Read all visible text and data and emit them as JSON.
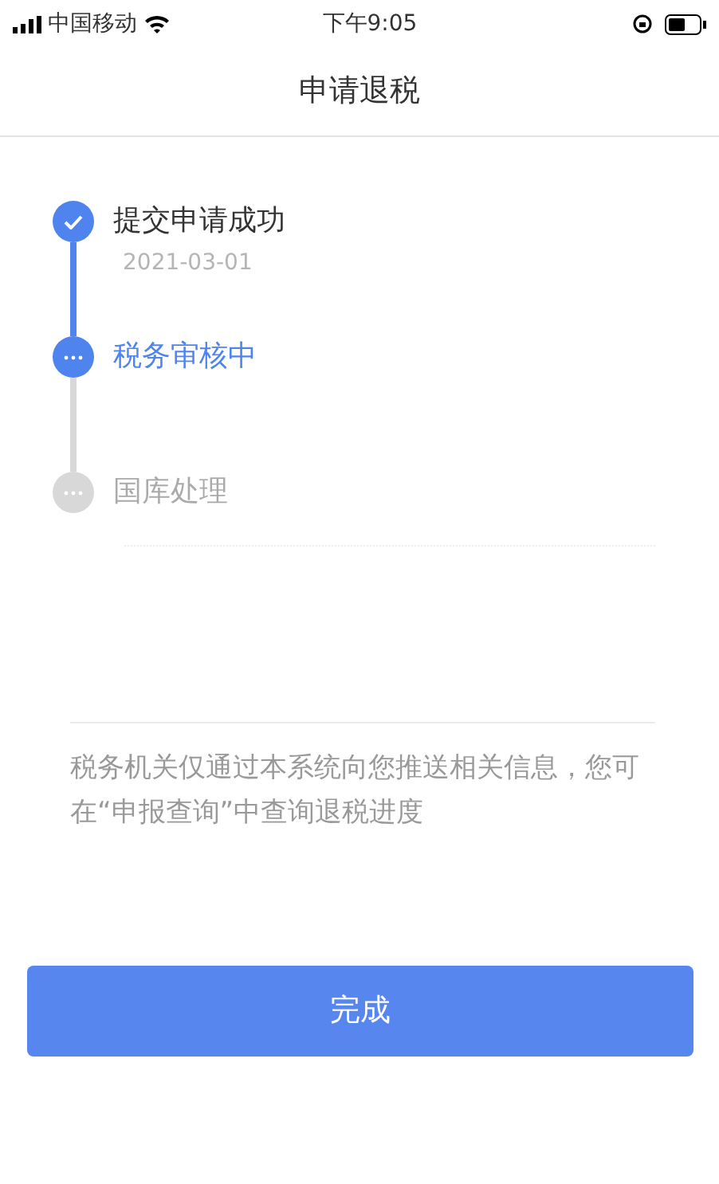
{
  "status_bar": {
    "carrier": "中国移动",
    "time": "下午9:05"
  },
  "header": {
    "title": "申请退税"
  },
  "steps": [
    {
      "label": "提交申请成功",
      "date": "2021-03-01",
      "kind": "done"
    },
    {
      "label": "税务审核中",
      "kind": "active"
    },
    {
      "label": "国库处理",
      "kind": "pending"
    }
  ],
  "note": "税务机关仅通过本系统向您推送相关信息，您可在“申报查询”中查询退税进度",
  "button": {
    "label": "完成"
  }
}
